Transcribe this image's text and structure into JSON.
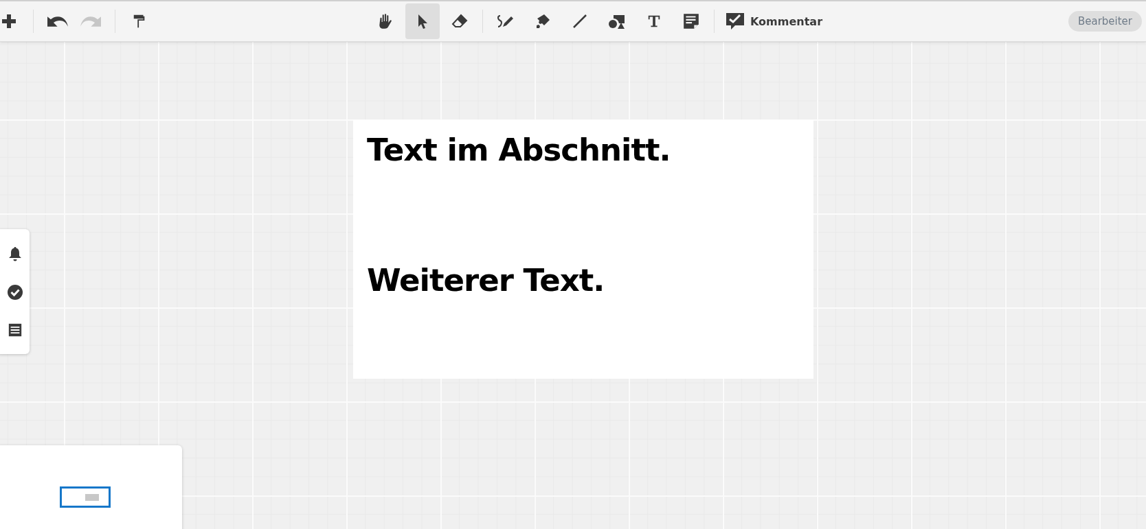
{
  "toolbar": {
    "left_tools": [
      {
        "kind": "add",
        "disabled": false
      },
      {
        "kind": "undo",
        "disabled": false
      },
      {
        "kind": "redo",
        "disabled": true
      },
      {
        "kind": "format-painter",
        "disabled": false
      }
    ],
    "tools": [
      {
        "kind": "hand",
        "selected": false
      },
      {
        "kind": "pointer",
        "selected": true
      },
      {
        "kind": "eraser",
        "selected": false
      },
      {
        "kind": "pen",
        "selected": false
      },
      {
        "kind": "marker",
        "selected": false
      },
      {
        "kind": "line",
        "selected": false
      },
      {
        "kind": "shapes",
        "selected": false
      },
      {
        "kind": "text",
        "selected": false
      },
      {
        "kind": "note",
        "selected": false
      }
    ],
    "comment": {
      "label": "Kommentar"
    },
    "role_badge": "Bearbeiter"
  },
  "canvas": {
    "text_block": {
      "paragraphs": [
        "Text im Abschnitt.",
        "Weiterer Text."
      ]
    }
  },
  "side_panel": {
    "items": [
      {
        "kind": "bell"
      },
      {
        "kind": "check"
      },
      {
        "kind": "list"
      }
    ]
  }
}
